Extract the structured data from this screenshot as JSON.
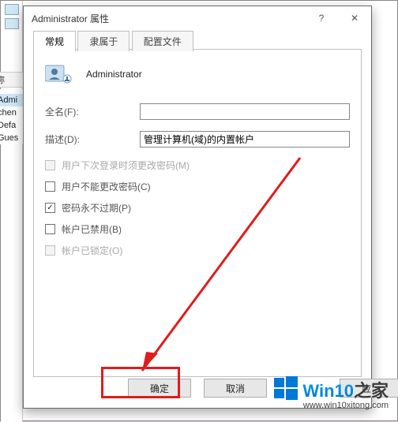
{
  "parent": {
    "name_header": "称",
    "items": [
      {
        "label": "Admi",
        "selected": true
      },
      {
        "label": "chen",
        "selected": false
      },
      {
        "label": "Defa",
        "selected": false
      },
      {
        "label": "Gues",
        "selected": false
      }
    ]
  },
  "dialog": {
    "title": "Administrator 属性",
    "help_icon": "?",
    "close_icon": "✕",
    "tabs": {
      "general": "常规",
      "memberof": "隶属于",
      "profile": "配置文件"
    },
    "user_name": "Administrator",
    "fullname_label": "全名(F):",
    "fullname_value": "",
    "desc_label": "描述(D):",
    "desc_value": "管理计算机(域)的内置帐户",
    "checks": {
      "mustchange": "用户下次登录时须更改密码(M)",
      "cannotchange": "用户不能更改密码(C)",
      "neverexpire": "密码永不过期(P)",
      "disabled": "帐户已禁用(B)",
      "locked": "帐户已锁定(O)"
    },
    "buttons": {
      "ok": "确定",
      "cancel": "取消",
      "apply": "应…"
    }
  },
  "watermark": {
    "text_a": "Win10",
    "text_b": "之家",
    "url": "www.win10xitong.com"
  }
}
